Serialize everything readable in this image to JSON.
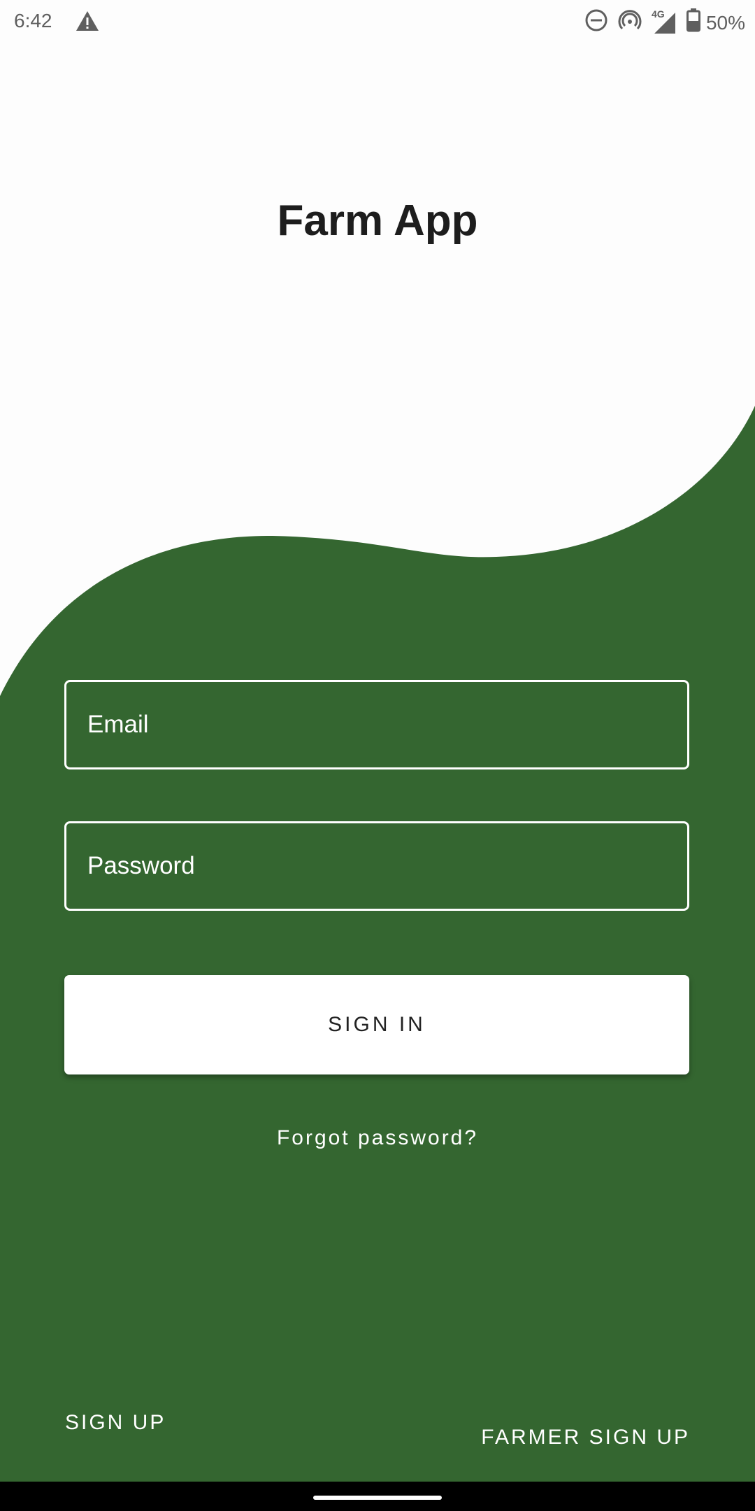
{
  "status_bar": {
    "time": "6:42",
    "network": "4G",
    "battery": "50%",
    "icons": [
      "warning-icon",
      "do-not-disturb-icon",
      "hotspot-icon",
      "signal-icon",
      "battery-icon"
    ]
  },
  "app": {
    "title": "Farm App",
    "background_color": "#fdfdfd",
    "accent_color": "#346630"
  },
  "login_form": {
    "email_placeholder": "Email",
    "email_value": "",
    "password_placeholder": "Password",
    "password_value": "",
    "sign_in_label": "SIGN IN",
    "forgot_password_label": "Forgot password?"
  },
  "footer": {
    "sign_up_label": "SIGN UP",
    "farmer_sign_up_label": "FARMER SIGN UP"
  }
}
